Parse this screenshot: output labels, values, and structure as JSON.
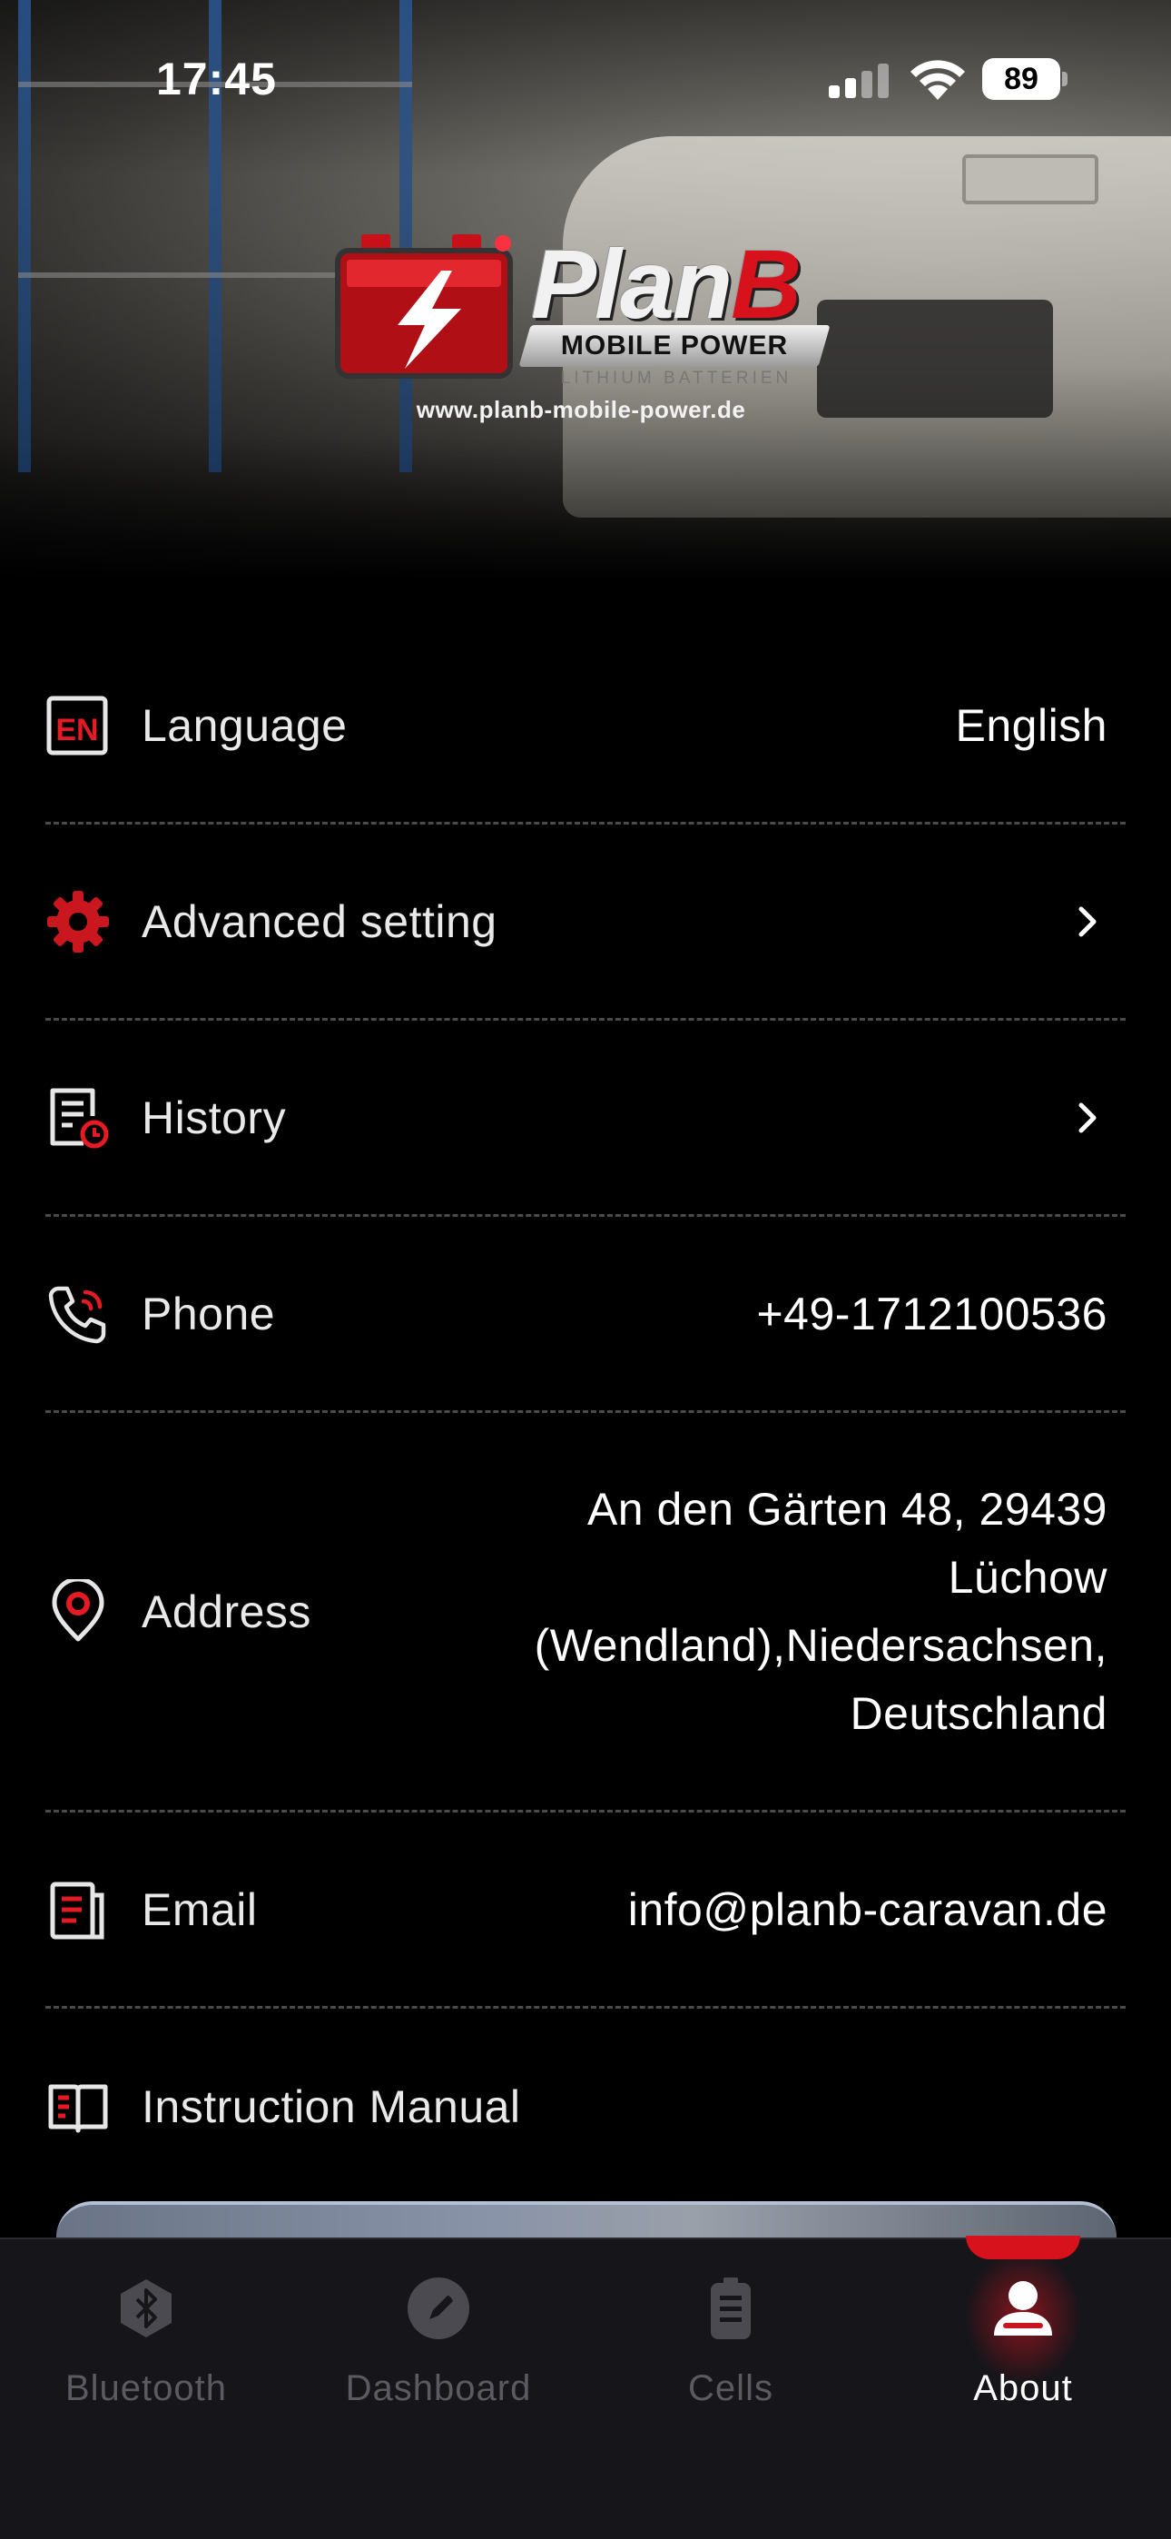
{
  "status_bar": {
    "time": "17:45",
    "battery_level": "89"
  },
  "hero": {
    "brand_name_plan": "Plan",
    "brand_name_b": "B",
    "brand_line": "MOBILE POWER",
    "brand_subline": "LITHIUM BATTERIEN",
    "brand_url": "www.planb-mobile-power.de"
  },
  "settings": {
    "language": {
      "label": "Language",
      "value": "English",
      "icon": "en-language-icon"
    },
    "advanced": {
      "label": "Advanced setting",
      "icon": "gear-icon"
    },
    "history": {
      "label": "History",
      "icon": "history-icon"
    },
    "phone": {
      "label": "Phone",
      "value": "+49-1712100536",
      "icon": "phone-icon"
    },
    "address": {
      "label": "Address",
      "value_lines": [
        "An den Gärten 48, 29439",
        "Lüchow",
        "(Wendland),Niedersachsen,",
        "Deutschland"
      ],
      "icon": "location-pin-icon"
    },
    "email": {
      "label": "Email",
      "value": "info@planb-caravan.de",
      "icon": "email-icon"
    },
    "manual": {
      "label": "Instruction Manual",
      "icon": "book-icon"
    }
  },
  "tabs": [
    {
      "label": "Bluetooth",
      "icon": "bluetooth-icon",
      "active": false
    },
    {
      "label": "Dashboard",
      "icon": "dashboard-icon",
      "active": false
    },
    {
      "label": "Cells",
      "icon": "battery-cells-icon",
      "active": false
    },
    {
      "label": "About",
      "icon": "user-icon",
      "active": true
    }
  ],
  "colors": {
    "accent": "#d8121c",
    "background": "#000000",
    "tabbar": "#15151a",
    "divider": "#4a4a4a"
  }
}
